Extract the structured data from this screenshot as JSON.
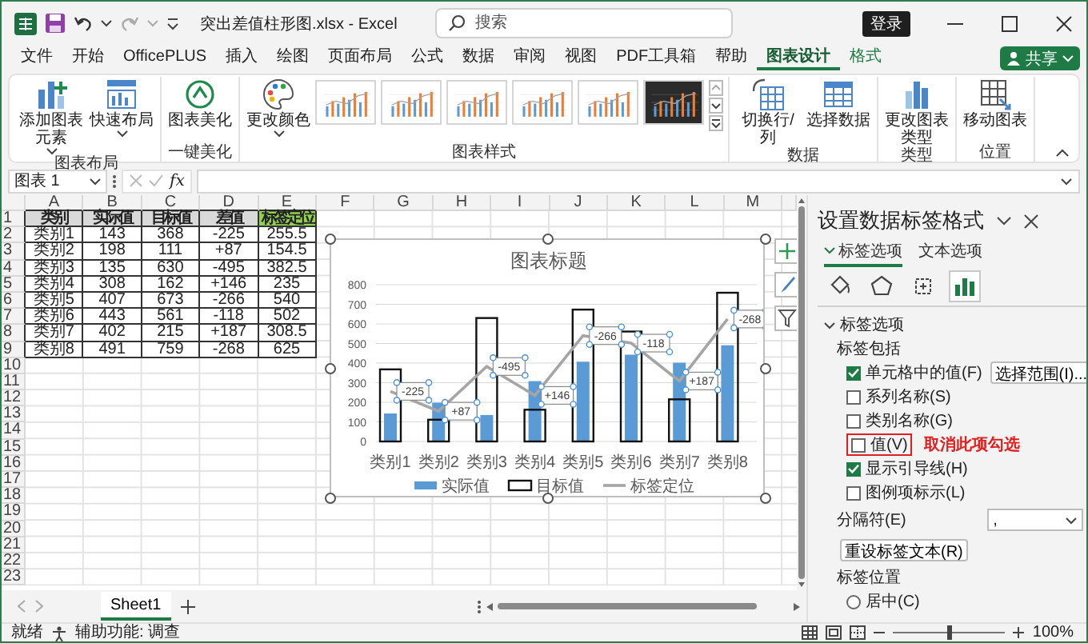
{
  "window": {
    "title": "突出差值柱形图.xlsx - Excel",
    "search_placeholder": "搜索",
    "sign_in": "登录"
  },
  "menu_tabs": [
    {
      "label": "文件",
      "selected": false,
      "kind": "normal"
    },
    {
      "label": "开始",
      "selected": false,
      "kind": "normal"
    },
    {
      "label": "OfficePLUS",
      "selected": false,
      "kind": "normal"
    },
    {
      "label": "插入",
      "selected": false,
      "kind": "normal"
    },
    {
      "label": "绘图",
      "selected": false,
      "kind": "normal"
    },
    {
      "label": "页面布局",
      "selected": false,
      "kind": "normal"
    },
    {
      "label": "公式",
      "selected": false,
      "kind": "normal"
    },
    {
      "label": "数据",
      "selected": false,
      "kind": "normal"
    },
    {
      "label": "审阅",
      "selected": false,
      "kind": "normal"
    },
    {
      "label": "视图",
      "selected": false,
      "kind": "normal"
    },
    {
      "label": "PDF工具箱",
      "selected": false,
      "kind": "normal"
    },
    {
      "label": "帮助",
      "selected": false,
      "kind": "normal"
    },
    {
      "label": "图表设计",
      "selected": true,
      "kind": "contextual"
    },
    {
      "label": "格式",
      "selected": false,
      "kind": "contextual"
    }
  ],
  "share_button": "共享",
  "ribbon": {
    "groups": [
      {
        "label": "图表布局",
        "commands": [
          {
            "label": "添加图表元素",
            "dropdown": true
          },
          {
            "label": "快速布局",
            "dropdown": true
          }
        ]
      },
      {
        "label": "一键美化",
        "commands": [
          {
            "label": "图表美化",
            "dropdown": false
          }
        ]
      },
      {
        "label": "图表样式",
        "commands": [
          {
            "label": "更改颜色",
            "dropdown": true
          }
        ],
        "gallery": [
          {
            "kind": "light"
          },
          {
            "kind": "light"
          },
          {
            "kind": "light"
          },
          {
            "kind": "light"
          },
          {
            "kind": "light"
          },
          {
            "kind": "dark"
          }
        ]
      },
      {
        "label": "数据",
        "commands": [
          {
            "label": "切换行/列",
            "dropdown": false
          },
          {
            "label": "选择数据",
            "dropdown": false
          }
        ]
      },
      {
        "label": "类型",
        "commands": [
          {
            "label": "更改图表类型",
            "dropdown": false
          }
        ]
      },
      {
        "label": "位置",
        "commands": [
          {
            "label": "移动图表",
            "dropdown": false
          }
        ]
      }
    ]
  },
  "formula_bar": {
    "name_box": "图表 1",
    "function_label": "fx"
  },
  "sheet": {
    "columns": [
      "A",
      "B",
      "C",
      "D",
      "E",
      "F",
      "G",
      "H",
      "I",
      "J",
      "K",
      "L",
      "M"
    ],
    "rows": [
      {
        "number": "1",
        "kind": "header",
        "cells": [
          {
            "text": "类别",
            "color": "#d9d9d9"
          },
          {
            "text": "实际值",
            "color": "#d9d9d9"
          },
          {
            "text": "目标值",
            "color": "#d9d9d9"
          },
          {
            "text": "差值",
            "color": "#d9d9d9"
          },
          {
            "text": "标签定位",
            "color": "#92d050"
          }
        ]
      },
      {
        "number": "2",
        "kind": "data",
        "cells": [
          "类别1",
          "143",
          "368",
          "-225",
          "255.5"
        ]
      },
      {
        "number": "3",
        "kind": "data",
        "cells": [
          "类别2",
          "198",
          "111",
          "+87",
          "154.5"
        ]
      },
      {
        "number": "4",
        "kind": "data",
        "cells": [
          "类别3",
          "135",
          "630",
          "-495",
          "382.5"
        ]
      },
      {
        "number": "5",
        "kind": "data",
        "cells": [
          "类别4",
          "308",
          "162",
          "+146",
          "235"
        ]
      },
      {
        "number": "6",
        "kind": "data",
        "cells": [
          "类别5",
          "407",
          "673",
          "-266",
          "540"
        ]
      },
      {
        "number": "7",
        "kind": "data",
        "cells": [
          "类别6",
          "443",
          "561",
          "-118",
          "502"
        ]
      },
      {
        "number": "8",
        "kind": "data",
        "cells": [
          "类别7",
          "402",
          "215",
          "+187",
          "308.5"
        ]
      },
      {
        "number": "9",
        "kind": "data",
        "cells": [
          "类别8",
          "491",
          "759",
          "-268",
          "625"
        ]
      },
      {
        "number": "10",
        "kind": "empty"
      },
      {
        "number": "11",
        "kind": "empty"
      },
      {
        "number": "12",
        "kind": "empty"
      },
      {
        "number": "13",
        "kind": "empty"
      },
      {
        "number": "14",
        "kind": "empty"
      },
      {
        "number": "15",
        "kind": "empty"
      },
      {
        "number": "16",
        "kind": "empty"
      },
      {
        "number": "17",
        "kind": "empty"
      },
      {
        "number": "18",
        "kind": "empty"
      },
      {
        "number": "19",
        "kind": "empty"
      },
      {
        "number": "20",
        "kind": "empty"
      },
      {
        "number": "21",
        "kind": "empty"
      },
      {
        "number": "22",
        "kind": "empty"
      },
      {
        "number": "23",
        "kind": "empty"
      }
    ],
    "chart": {
      "selected": true,
      "chart_data": {
        "type": "bar",
        "title": "图表标题",
        "categories": [
          "类别1",
          "类别2",
          "类别3",
          "类别4",
          "类别5",
          "类别6",
          "类别7",
          "类别8"
        ],
        "series": [
          {
            "name": "实际值",
            "type": "bar",
            "color": "#5b9bd5",
            "values": [
              143,
              198,
              135,
              308,
              407,
              443,
              402,
              491
            ]
          },
          {
            "name": "目标值",
            "type": "bar",
            "color": "#111111",
            "values": [
              368,
              111,
              630,
              162,
              673,
              561,
              215,
              759
            ]
          },
          {
            "name": "标签定位",
            "type": "line",
            "color": "#a5a5a5",
            "values": [
              255.5,
              154.5,
              382.5,
              235,
              540,
              502,
              308.5,
              625
            ]
          }
        ],
        "ylim": [
          0,
          800
        ],
        "yticks": [
          0,
          100,
          200,
          300,
          400,
          500,
          600,
          700,
          800
        ],
        "grid": true,
        "legend": true,
        "annotations": [
          {
            "text": "-225"
          },
          {
            "text": "+87"
          },
          {
            "text": "-495"
          },
          {
            "text": "+146"
          },
          {
            "text": "-266"
          },
          {
            "text": "-118"
          },
          {
            "text": "+187"
          },
          {
            "text": "-268"
          }
        ]
      }
    }
  },
  "sheet_tabs": [
    {
      "label": "Sheet1",
      "selected": true
    }
  ],
  "format_pane": {
    "title": "设置数据标签格式",
    "tabs": [
      {
        "label": "标签选项",
        "selected": true
      },
      {
        "label": "文本选项",
        "selected": false
      }
    ],
    "icon_tabs": [
      {
        "selected": false
      },
      {
        "selected": false
      },
      {
        "selected": false
      },
      {
        "selected": true
      }
    ],
    "section": {
      "title": "标签选项",
      "expanded": true
    },
    "include_label": "标签包括",
    "options": [
      {
        "label": "单元格中的值(F)",
        "checked": true,
        "highlighted": false,
        "button": "选择范围(I)..."
      },
      {
        "label": "系列名称(S)",
        "checked": false,
        "highlighted": false
      },
      {
        "label": "类别名称(G)",
        "checked": false,
        "highlighted": false
      },
      {
        "label": "值(V)",
        "checked": false,
        "highlighted": true,
        "note": "取消此项勾选"
      },
      {
        "label": "显示引导线(H)",
        "checked": true,
        "highlighted": false
      },
      {
        "label": "图例项标示(L)",
        "checked": false,
        "highlighted": false
      }
    ],
    "separator": {
      "label": "分隔符(E)",
      "value": ","
    },
    "reset_button": "重设标签文本(R)",
    "position_label": "标签位置",
    "positions": [
      {
        "label": "居中(C)",
        "selected": false
      }
    ]
  },
  "status_bar": {
    "ready": "就绪",
    "accessibility": "辅助功能: 调查",
    "zoom": {
      "level": 0.5,
      "reading": "100%"
    }
  }
}
